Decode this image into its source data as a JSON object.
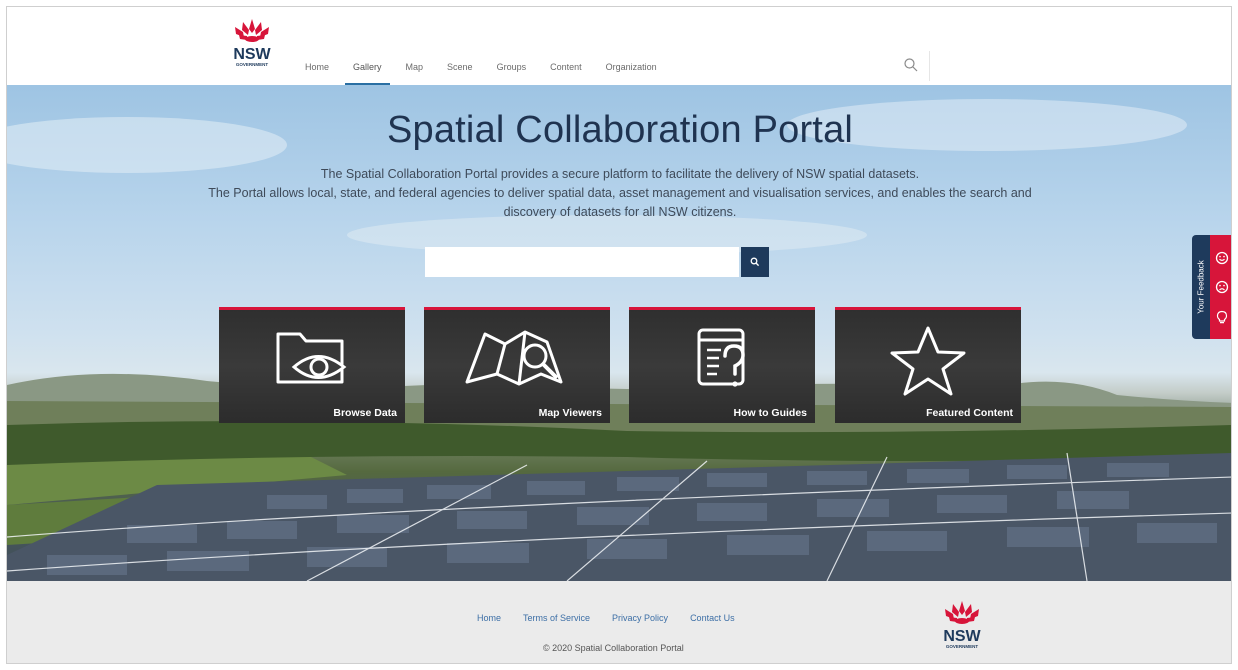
{
  "brand": {
    "logo_text": "NSW",
    "logo_subtext": "GOVERNMENT"
  },
  "nav": {
    "items": [
      {
        "label": "Home",
        "active": false
      },
      {
        "label": "Gallery",
        "active": true
      },
      {
        "label": "Map",
        "active": false
      },
      {
        "label": "Scene",
        "active": false
      },
      {
        "label": "Groups",
        "active": false
      },
      {
        "label": "Content",
        "active": false
      },
      {
        "label": "Organization",
        "active": false
      }
    ],
    "search_icon": "search-icon"
  },
  "hero": {
    "title": "Spatial Collaboration Portal",
    "description_line1": "The Spatial Collaboration Portal provides a secure platform to facilitate the delivery of NSW spatial datasets.",
    "description_line2": "The Portal allows local, state, and federal agencies to deliver spatial data, asset management and visualisation services, and enables the search and discovery of datasets for all NSW citizens.",
    "search": {
      "value": "",
      "placeholder": ""
    }
  },
  "tiles": [
    {
      "label": "Browse Data",
      "icon": "folder-eye-icon"
    },
    {
      "label": "Map Viewers",
      "icon": "map-search-icon"
    },
    {
      "label": "How to Guides",
      "icon": "document-question-icon"
    },
    {
      "label": "Featured Content",
      "icon": "star-icon"
    }
  ],
  "feedback": {
    "label": "Your Feedback",
    "icons": [
      "smile-icon",
      "frown-icon",
      "lightbulb-icon"
    ]
  },
  "footer": {
    "links": [
      "Home",
      "Terms of Service",
      "Privacy Policy",
      "Contact Us"
    ],
    "copyright": "© 2020 Spatial Collaboration Portal"
  },
  "colors": {
    "accent_red": "#d7153a",
    "navy": "#1e3a5c",
    "link_blue": "#3d6fa6",
    "nav_underline": "#2a6fa3"
  }
}
